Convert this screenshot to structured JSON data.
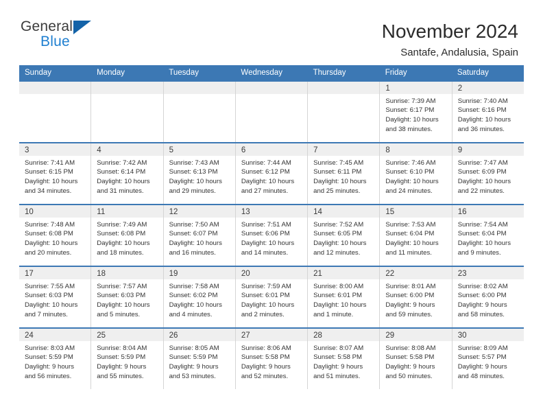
{
  "brand": {
    "name_part1": "General",
    "name_part2": "Blue",
    "triangle_color": "#1463a8",
    "blue_color": "#1f7fd0"
  },
  "header": {
    "title": "November 2024",
    "subtitle": "Santafe, Andalusia, Spain"
  },
  "theme": {
    "header_blue": "#3c78b4",
    "day_band": "#efefef",
    "grid_line": "#d4d4d4"
  },
  "weekdays": [
    "Sunday",
    "Monday",
    "Tuesday",
    "Wednesday",
    "Thursday",
    "Friday",
    "Saturday"
  ],
  "weeks": [
    [
      {
        "day": "",
        "empty": true,
        "sunrise": "",
        "sunset": "",
        "daylight_line1": "",
        "daylight_line2": ""
      },
      {
        "day": "",
        "empty": true,
        "sunrise": "",
        "sunset": "",
        "daylight_line1": "",
        "daylight_line2": ""
      },
      {
        "day": "",
        "empty": true,
        "sunrise": "",
        "sunset": "",
        "daylight_line1": "",
        "daylight_line2": ""
      },
      {
        "day": "",
        "empty": true,
        "sunrise": "",
        "sunset": "",
        "daylight_line1": "",
        "daylight_line2": ""
      },
      {
        "day": "",
        "empty": true,
        "sunrise": "",
        "sunset": "",
        "daylight_line1": "",
        "daylight_line2": ""
      },
      {
        "day": "1",
        "empty": false,
        "sunrise": "Sunrise: 7:39 AM",
        "sunset": "Sunset: 6:17 PM",
        "daylight_line1": "Daylight: 10 hours",
        "daylight_line2": "and 38 minutes."
      },
      {
        "day": "2",
        "empty": false,
        "sunrise": "Sunrise: 7:40 AM",
        "sunset": "Sunset: 6:16 PM",
        "daylight_line1": "Daylight: 10 hours",
        "daylight_line2": "and 36 minutes."
      }
    ],
    [
      {
        "day": "3",
        "empty": false,
        "sunrise": "Sunrise: 7:41 AM",
        "sunset": "Sunset: 6:15 PM",
        "daylight_line1": "Daylight: 10 hours",
        "daylight_line2": "and 34 minutes."
      },
      {
        "day": "4",
        "empty": false,
        "sunrise": "Sunrise: 7:42 AM",
        "sunset": "Sunset: 6:14 PM",
        "daylight_line1": "Daylight: 10 hours",
        "daylight_line2": "and 31 minutes."
      },
      {
        "day": "5",
        "empty": false,
        "sunrise": "Sunrise: 7:43 AM",
        "sunset": "Sunset: 6:13 PM",
        "daylight_line1": "Daylight: 10 hours",
        "daylight_line2": "and 29 minutes."
      },
      {
        "day": "6",
        "empty": false,
        "sunrise": "Sunrise: 7:44 AM",
        "sunset": "Sunset: 6:12 PM",
        "daylight_line1": "Daylight: 10 hours",
        "daylight_line2": "and 27 minutes."
      },
      {
        "day": "7",
        "empty": false,
        "sunrise": "Sunrise: 7:45 AM",
        "sunset": "Sunset: 6:11 PM",
        "daylight_line1": "Daylight: 10 hours",
        "daylight_line2": "and 25 minutes."
      },
      {
        "day": "8",
        "empty": false,
        "sunrise": "Sunrise: 7:46 AM",
        "sunset": "Sunset: 6:10 PM",
        "daylight_line1": "Daylight: 10 hours",
        "daylight_line2": "and 24 minutes."
      },
      {
        "day": "9",
        "empty": false,
        "sunrise": "Sunrise: 7:47 AM",
        "sunset": "Sunset: 6:09 PM",
        "daylight_line1": "Daylight: 10 hours",
        "daylight_line2": "and 22 minutes."
      }
    ],
    [
      {
        "day": "10",
        "empty": false,
        "sunrise": "Sunrise: 7:48 AM",
        "sunset": "Sunset: 6:08 PM",
        "daylight_line1": "Daylight: 10 hours",
        "daylight_line2": "and 20 minutes."
      },
      {
        "day": "11",
        "empty": false,
        "sunrise": "Sunrise: 7:49 AM",
        "sunset": "Sunset: 6:08 PM",
        "daylight_line1": "Daylight: 10 hours",
        "daylight_line2": "and 18 minutes."
      },
      {
        "day": "12",
        "empty": false,
        "sunrise": "Sunrise: 7:50 AM",
        "sunset": "Sunset: 6:07 PM",
        "daylight_line1": "Daylight: 10 hours",
        "daylight_line2": "and 16 minutes."
      },
      {
        "day": "13",
        "empty": false,
        "sunrise": "Sunrise: 7:51 AM",
        "sunset": "Sunset: 6:06 PM",
        "daylight_line1": "Daylight: 10 hours",
        "daylight_line2": "and 14 minutes."
      },
      {
        "day": "14",
        "empty": false,
        "sunrise": "Sunrise: 7:52 AM",
        "sunset": "Sunset: 6:05 PM",
        "daylight_line1": "Daylight: 10 hours",
        "daylight_line2": "and 12 minutes."
      },
      {
        "day": "15",
        "empty": false,
        "sunrise": "Sunrise: 7:53 AM",
        "sunset": "Sunset: 6:04 PM",
        "daylight_line1": "Daylight: 10 hours",
        "daylight_line2": "and 11 minutes."
      },
      {
        "day": "16",
        "empty": false,
        "sunrise": "Sunrise: 7:54 AM",
        "sunset": "Sunset: 6:04 PM",
        "daylight_line1": "Daylight: 10 hours",
        "daylight_line2": "and 9 minutes."
      }
    ],
    [
      {
        "day": "17",
        "empty": false,
        "sunrise": "Sunrise: 7:55 AM",
        "sunset": "Sunset: 6:03 PM",
        "daylight_line1": "Daylight: 10 hours",
        "daylight_line2": "and 7 minutes."
      },
      {
        "day": "18",
        "empty": false,
        "sunrise": "Sunrise: 7:57 AM",
        "sunset": "Sunset: 6:03 PM",
        "daylight_line1": "Daylight: 10 hours",
        "daylight_line2": "and 5 minutes."
      },
      {
        "day": "19",
        "empty": false,
        "sunrise": "Sunrise: 7:58 AM",
        "sunset": "Sunset: 6:02 PM",
        "daylight_line1": "Daylight: 10 hours",
        "daylight_line2": "and 4 minutes."
      },
      {
        "day": "20",
        "empty": false,
        "sunrise": "Sunrise: 7:59 AM",
        "sunset": "Sunset: 6:01 PM",
        "daylight_line1": "Daylight: 10 hours",
        "daylight_line2": "and 2 minutes."
      },
      {
        "day": "21",
        "empty": false,
        "sunrise": "Sunrise: 8:00 AM",
        "sunset": "Sunset: 6:01 PM",
        "daylight_line1": "Daylight: 10 hours",
        "daylight_line2": "and 1 minute."
      },
      {
        "day": "22",
        "empty": false,
        "sunrise": "Sunrise: 8:01 AM",
        "sunset": "Sunset: 6:00 PM",
        "daylight_line1": "Daylight: 9 hours",
        "daylight_line2": "and 59 minutes."
      },
      {
        "day": "23",
        "empty": false,
        "sunrise": "Sunrise: 8:02 AM",
        "sunset": "Sunset: 6:00 PM",
        "daylight_line1": "Daylight: 9 hours",
        "daylight_line2": "and 58 minutes."
      }
    ],
    [
      {
        "day": "24",
        "empty": false,
        "sunrise": "Sunrise: 8:03 AM",
        "sunset": "Sunset: 5:59 PM",
        "daylight_line1": "Daylight: 9 hours",
        "daylight_line2": "and 56 minutes."
      },
      {
        "day": "25",
        "empty": false,
        "sunrise": "Sunrise: 8:04 AM",
        "sunset": "Sunset: 5:59 PM",
        "daylight_line1": "Daylight: 9 hours",
        "daylight_line2": "and 55 minutes."
      },
      {
        "day": "26",
        "empty": false,
        "sunrise": "Sunrise: 8:05 AM",
        "sunset": "Sunset: 5:59 PM",
        "daylight_line1": "Daylight: 9 hours",
        "daylight_line2": "and 53 minutes."
      },
      {
        "day": "27",
        "empty": false,
        "sunrise": "Sunrise: 8:06 AM",
        "sunset": "Sunset: 5:58 PM",
        "daylight_line1": "Daylight: 9 hours",
        "daylight_line2": "and 52 minutes."
      },
      {
        "day": "28",
        "empty": false,
        "sunrise": "Sunrise: 8:07 AM",
        "sunset": "Sunset: 5:58 PM",
        "daylight_line1": "Daylight: 9 hours",
        "daylight_line2": "and 51 minutes."
      },
      {
        "day": "29",
        "empty": false,
        "sunrise": "Sunrise: 8:08 AM",
        "sunset": "Sunset: 5:58 PM",
        "daylight_line1": "Daylight: 9 hours",
        "daylight_line2": "and 50 minutes."
      },
      {
        "day": "30",
        "empty": false,
        "sunrise": "Sunrise: 8:09 AM",
        "sunset": "Sunset: 5:57 PM",
        "daylight_line1": "Daylight: 9 hours",
        "daylight_line2": "and 48 minutes."
      }
    ]
  ]
}
